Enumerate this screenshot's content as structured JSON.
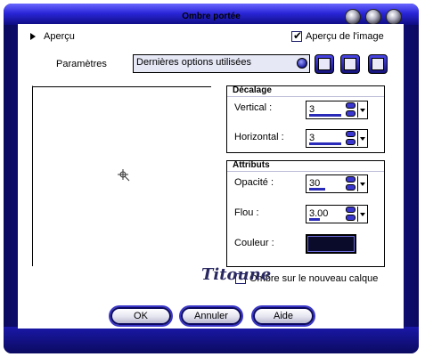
{
  "window": {
    "title": "Ombre portée"
  },
  "header": {
    "preview_toggle_label": "Aperçu",
    "image_preview_label": "Aperçu de l'image",
    "image_preview_checked": true
  },
  "params": {
    "label": "Paramètres",
    "selected": "Dernières options utilisées"
  },
  "offset": {
    "title": "Décalage",
    "vertical_label": "Vertical :",
    "vertical_value": "3",
    "horizontal_label": "Horizontal :",
    "horizontal_value": "3"
  },
  "attributes": {
    "title": "Attributs",
    "opacity_label": "Opacité :",
    "opacity_value": "30",
    "blur_label": "Flou :",
    "blur_value": "3.00",
    "color_label": "Couleur :",
    "color_value": "#0a0a2a"
  },
  "new_layer": {
    "label": "Ombre sur le nouveau calque",
    "checked": false
  },
  "signature": "Titoune",
  "buttons": {
    "ok": "OK",
    "cancel": "Annuler",
    "help": "Aide"
  },
  "icons": [
    "save-preset-icon",
    "reset-preset-icon",
    "load-preset-icon",
    "crosshair-icon",
    "check-icon"
  ],
  "colors": {
    "frame_accent": "#2a26d8",
    "frame_dark": "#0b0a60"
  }
}
